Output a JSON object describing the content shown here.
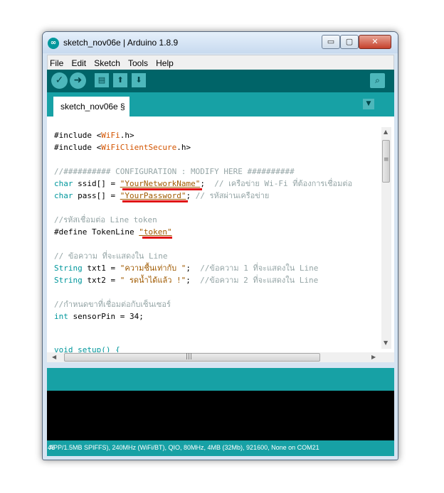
{
  "window": {
    "title": "sketch_nov06e | Arduino 1.8.9",
    "min_glyph": "▭",
    "max_glyph": "▢",
    "close_glyph": "✕"
  },
  "menu": [
    "File",
    "Edit",
    "Sketch",
    "Tools",
    "Help"
  ],
  "toolbar": {
    "verify_icon": "✓",
    "upload_icon": "➜",
    "new_icon": "▤",
    "open_icon": "⬆",
    "save_icon": "⬇",
    "serial_icon": "⌕"
  },
  "tab": {
    "label": "sketch_nov06e §",
    "menu_glyph": "▼"
  },
  "code": {
    "l1a": "#include <",
    "l1b": "WiFi",
    "l1c": ".h>",
    "l2a": "#include <",
    "l2b": "WiFiClientSecure",
    "l2c": ".h>",
    "l3": "//########## CONFIGURATION : MODIFY HERE ##########",
    "l4a": "char",
    "l4b": " ssid[] = ",
    "l4c": "\"YourNetworkName\"",
    "l4d": ";  ",
    "l4e": "// เครือข่าย Wi-Fi ที่ต้องการเชื่อมต่อ",
    "l5a": "char",
    "l5b": " pass[] = ",
    "l5c": "\"YourPassword\"",
    "l5d": "; ",
    "l5e": "// รหัสผ่านเครือข่าย",
    "l6": "//รหัสเชื่อมต่อ Line token",
    "l7a": "#define TokenLine ",
    "l7b": "\"token\"",
    "l8": "// ข้อความ ที่จะแสดงใน Line",
    "l9a": "String",
    "l9b": " txt1 = ",
    "l9c": "\"ความชื้นเท่ากับ \"",
    "l9d": ";  ",
    "l9e": "//ข้อความ 1 ที่จะแสดงใน Line",
    "l10a": "String",
    "l10b": " txt2 = ",
    "l10c": "\" รดน้ำได้แล้ว !\"",
    "l10d": ";  ",
    "l10e": "//ข้อความ 2 ที่จะแสดงใน Line",
    "l11": "//กำหนดขาที่เชื่อมต่อกับเซ็นเซอร์",
    "l12a": "int",
    "l12b": " sensorPin = 34;",
    "l13": "void setup() {"
  },
  "scroll": {
    "up": "▲",
    "down": "▼",
    "left": "◀",
    "right": "▶",
    "grip_h": "|||",
    "grip_v": "≡"
  },
  "status": {
    "line_number": "48",
    "board_info": "APP/1.5MB SPIFFS), 240MHz (WiFi/BT), QIO, 80MHz, 4MB (32Mb), 921600, None on COM21"
  },
  "colors": {
    "teal_dark": "#006468",
    "teal": "#17a1a5",
    "teal_light": "#4db7bb",
    "keyword": "#00979c",
    "underline": "#e01010"
  }
}
